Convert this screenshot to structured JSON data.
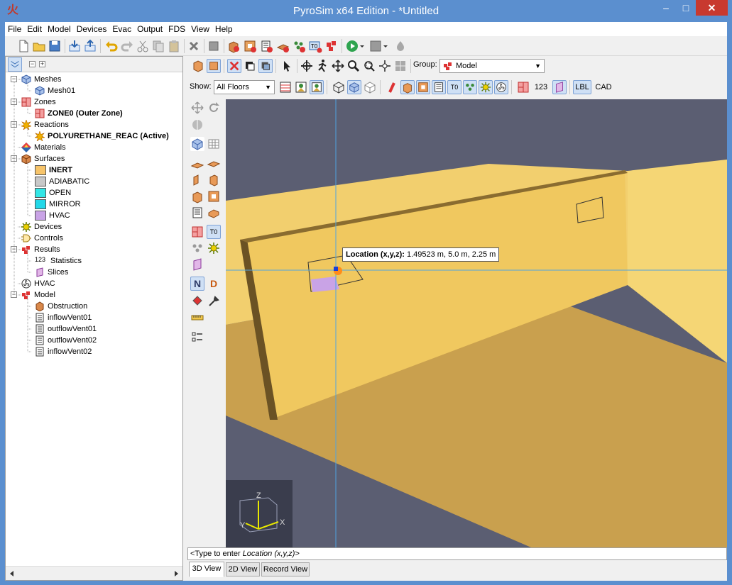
{
  "window": {
    "title": "PyroSim x64 Edition - *Untitled",
    "minimize_glyph": "–",
    "maximize_glyph": "□",
    "close_glyph": "✕"
  },
  "menu": [
    "File",
    "Edit",
    "Model",
    "Devices",
    "Evac",
    "Output",
    "FDS",
    "View",
    "Help"
  ],
  "tree": {
    "meshes": "Meshes",
    "mesh01": "Mesh01",
    "zones": "Zones",
    "zone0": "ZONE0 (Outer Zone)",
    "reactions": "Reactions",
    "reaction": "POLYURETHANE_REAC (Active)",
    "materials": "Materials",
    "surfaces": "Surfaces",
    "surf_inert": "INERT",
    "surf_adiabatic": "ADIABATIC",
    "surf_open": "OPEN",
    "surf_mirror": "MIRROR",
    "surf_hvac": "HVAC",
    "devices": "Devices",
    "controls": "Controls",
    "results": "Results",
    "statistics": "Statistics",
    "statistics_prefix": "123",
    "slices": "Slices",
    "hvac": "HVAC",
    "model": "Model",
    "obstruction": "Obstruction",
    "inflow01": "inflowVent01",
    "outflow01": "outflowVent01",
    "outflow02": "outflowVent02",
    "inflow02": "inflowVent02"
  },
  "surface_colors": {
    "inert": "#f7c46a",
    "adiabatic": "#c8c8c8",
    "open": "#33e6e6",
    "mirror": "#22d8e8",
    "hvac": "#c9a3e6"
  },
  "view": {
    "group_label": "Group:",
    "group_value": "Model",
    "show_label": "Show:",
    "show_value": "All Floors",
    "lbl_button": "LBL",
    "cad_button": "CAD",
    "n_button": "N",
    "d_button": "D",
    "t0_label": "T0",
    "numbers_label": "123"
  },
  "tooltip": {
    "label": "Location (x,y,z):",
    "value": "1.49523 m, 5.0 m, 2.25 m"
  },
  "cmdline": {
    "prefix": "<Type to enter ",
    "field": "Location (x,y,z)",
    "suffix": ">"
  },
  "tabs": [
    "3D View",
    "2D View",
    "Record View"
  ],
  "axes": {
    "x": "X",
    "y": "Y",
    "z": "Z"
  },
  "colors": {
    "sky": "#5b5e72",
    "floor": "#c9a04e",
    "wall": "#f2cf6e",
    "accent": "#3f7fd6"
  }
}
